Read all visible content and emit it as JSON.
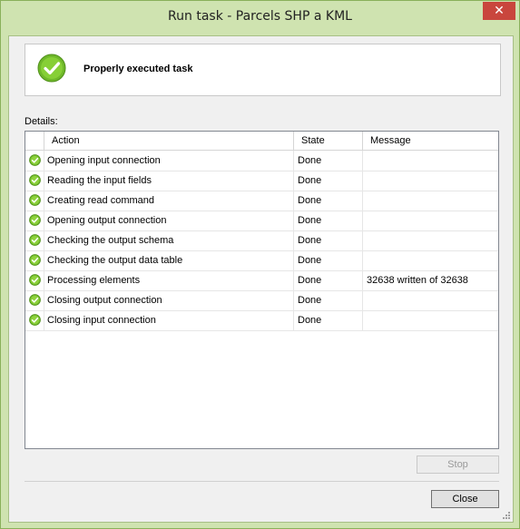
{
  "window": {
    "title": "Run task - Parcels SHP a KML",
    "close_glyph": "✕",
    "accent_color": "#cfe3b0"
  },
  "header": {
    "status_icon": "check-circle-icon",
    "status_color": "#7cc42c",
    "message": "Properly executed task"
  },
  "details": {
    "label": "Details:",
    "columns": [
      "Action",
      "State",
      "Message"
    ],
    "rows": [
      {
        "icon": "check-circle-icon",
        "action": "Opening input connection",
        "state": "Done",
        "message": ""
      },
      {
        "icon": "check-circle-icon",
        "action": "Reading the input fields",
        "state": "Done",
        "message": ""
      },
      {
        "icon": "check-circle-icon",
        "action": "Creating read command",
        "state": "Done",
        "message": ""
      },
      {
        "icon": "check-circle-icon",
        "action": "Opening output connection",
        "state": "Done",
        "message": ""
      },
      {
        "icon": "check-circle-icon",
        "action": "Checking the output schema",
        "state": "Done",
        "message": ""
      },
      {
        "icon": "check-circle-icon",
        "action": "Checking the output data table",
        "state": "Done",
        "message": ""
      },
      {
        "icon": "check-circle-icon",
        "action": "Processing elements",
        "state": "Done",
        "message": "32638 written of 32638"
      },
      {
        "icon": "check-circle-icon",
        "action": "Closing output connection",
        "state": "Done",
        "message": ""
      },
      {
        "icon": "check-circle-icon",
        "action": "Closing input connection",
        "state": "Done",
        "message": ""
      }
    ]
  },
  "buttons": {
    "stop_label": "Stop",
    "close_label": "Close"
  }
}
